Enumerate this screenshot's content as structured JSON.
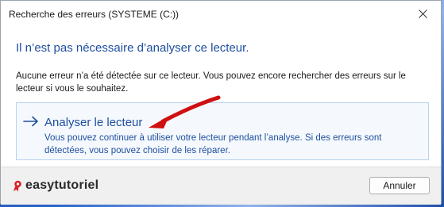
{
  "window": {
    "title": "Recherche des erreurs (SYSTEME (C:))"
  },
  "dialog": {
    "main_instruction": "Il n’est pas nécessaire d’analyser ce lecteur.",
    "content": "Aucune erreur n’a été détectée sur ce lecteur. Vous pouvez encore rechercher des erreurs sur le lecteur si vous le souhaitez.",
    "command_link": {
      "title": "Analyser le lecteur",
      "description": "Vous pouvez continuer à utiliser votre lecteur pendant l’analyse. Si des erreurs sont détectées, vous pouvez choisir de les réparer.",
      "icon": "arrow-right-icon"
    },
    "cancel_label": "Annuler"
  },
  "watermark": {
    "text": "easytutoriel"
  },
  "colors": {
    "accent": "#1f4fa0",
    "annotation_arrow": "#d01010",
    "logo_mark": "#d8232a"
  }
}
